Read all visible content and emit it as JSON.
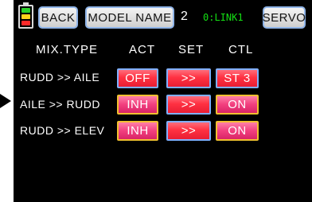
{
  "header": {
    "back_label": "BACK",
    "model_name_label": "MODEL NAME",
    "model_number": "2",
    "link_label": "0:LINK1",
    "servo_label": "SERVO"
  },
  "battery": {
    "colors": [
      "#2bd12b",
      "#ffd21c",
      "#ff2a2a"
    ]
  },
  "columns": {
    "mix_type": "MIX.TYPE",
    "act": "ACT",
    "set": "SET",
    "ctl": "CTL"
  },
  "rows": [
    {
      "mix": "RUDD >> AILE",
      "act": "OFF",
      "set": ">>",
      "ctl": "ST 3"
    },
    {
      "mix": "AILE >> RUDD",
      "act": "INH",
      "set": ">>",
      "ctl": "ON"
    },
    {
      "mix": "RUDD >> ELEV",
      "act": "INH",
      "set": ">>",
      "ctl": "ON"
    }
  ]
}
